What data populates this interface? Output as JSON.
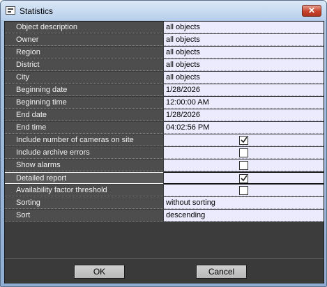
{
  "window": {
    "title": "Statistics",
    "close_glyph": "✕"
  },
  "properties": [
    {
      "label": "Object description",
      "value": "all objects"
    },
    {
      "label": "Owner",
      "value": "all objects"
    },
    {
      "label": "Region",
      "value": "all objects"
    },
    {
      "label": "District",
      "value": "all objects"
    },
    {
      "label": "City",
      "value": "all objects"
    },
    {
      "label": "Beginning date",
      "value": "1/28/2026"
    },
    {
      "label": "Beginning time",
      "value": "12:00:00 AM"
    },
    {
      "label": "End date",
      "value": "1/28/2026"
    },
    {
      "label": "End time",
      "value": "04:02:56 PM"
    },
    {
      "label": "Include number of cameras on site",
      "checked": true
    },
    {
      "label": "Include archive errors",
      "checked": false
    },
    {
      "label": "Show alarms",
      "checked": false
    },
    {
      "label": "Detailed report",
      "checked": true,
      "selected": true
    },
    {
      "label": "Availability factor threshold",
      "checked": false
    },
    {
      "label": "Sorting",
      "value": "without sorting"
    },
    {
      "label": "Sort",
      "value": "descending"
    }
  ],
  "buttons": {
    "ok": "OK",
    "cancel": "Cancel"
  },
  "colors": {
    "label_bg": "#4d4d4d",
    "value_bg": "#ecebfd",
    "panel_bg": "#3c3c3c"
  }
}
